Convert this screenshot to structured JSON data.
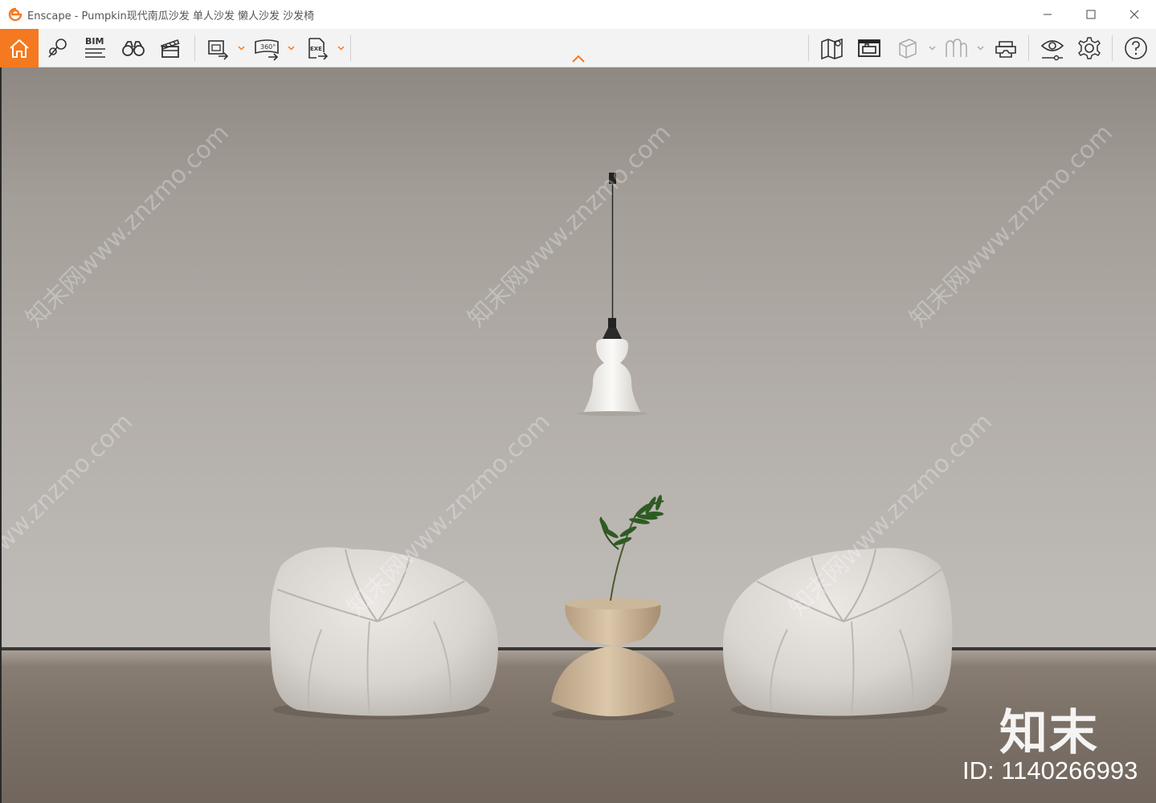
{
  "window": {
    "app_name": "Enscape",
    "title": "Enscape - Pumpkin现代南瓜沙发 单人沙发 懒人沙发 沙发椅"
  },
  "toolbar": {
    "bim_label": "BIM",
    "video_360_label": "360°",
    "exe_label": "EXE",
    "left_tools": [
      "home-icon",
      "location-pin-icon",
      "bim-icon",
      "binoculars-icon",
      "clapperboard-icon",
      "screenshot-export-icon",
      "panorama-360-icon",
      "exe-export-icon"
    ],
    "right_tools": [
      "map-icon",
      "asset-library-icon",
      "cube-view-icon",
      "model-view-icon",
      "vr-headset-icon",
      "visual-settings-eye-icon",
      "settings-gear-icon",
      "help-icon"
    ]
  },
  "viewport": {
    "watermark_text": "知末网www.znzmo.com",
    "brand_mark": "知末",
    "id_text": "ID: 1140266993"
  },
  "colors": {
    "accent": "#f47920",
    "toolbar_bg": "#f3f3f3",
    "icon": "#333333"
  }
}
